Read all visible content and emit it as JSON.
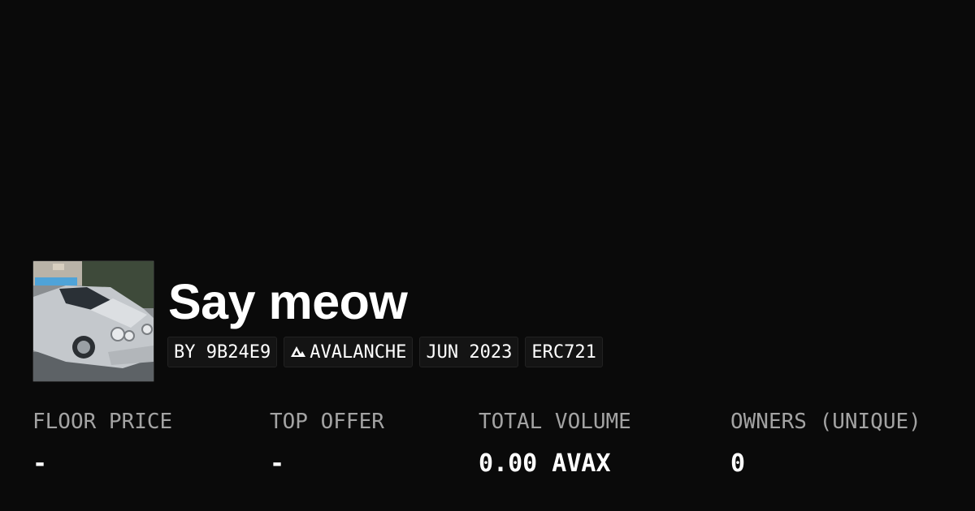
{
  "collection": {
    "title": "Say meow",
    "image_icon": "car-photo-icon",
    "tags": {
      "creator": "BY 9B24E9",
      "chain": "AVALANCHE",
      "chain_icon": "avalanche-logo-icon",
      "date": "JUN 2023",
      "standard": "ERC721"
    }
  },
  "stats": {
    "floor_price": {
      "label": "FLOOR PRICE",
      "value": "-"
    },
    "top_offer": {
      "label": "TOP OFFER",
      "value": "-"
    },
    "total_volume": {
      "label": "TOTAL VOLUME",
      "value": "0.00 AVAX"
    },
    "owners": {
      "label": "OWNERS (UNIQUE)",
      "value": "0"
    }
  },
  "colors": {
    "background": "#0a0a0a",
    "text": "#ffffff",
    "muted_text": "#a3a3a3",
    "tag_background": "#141414"
  }
}
